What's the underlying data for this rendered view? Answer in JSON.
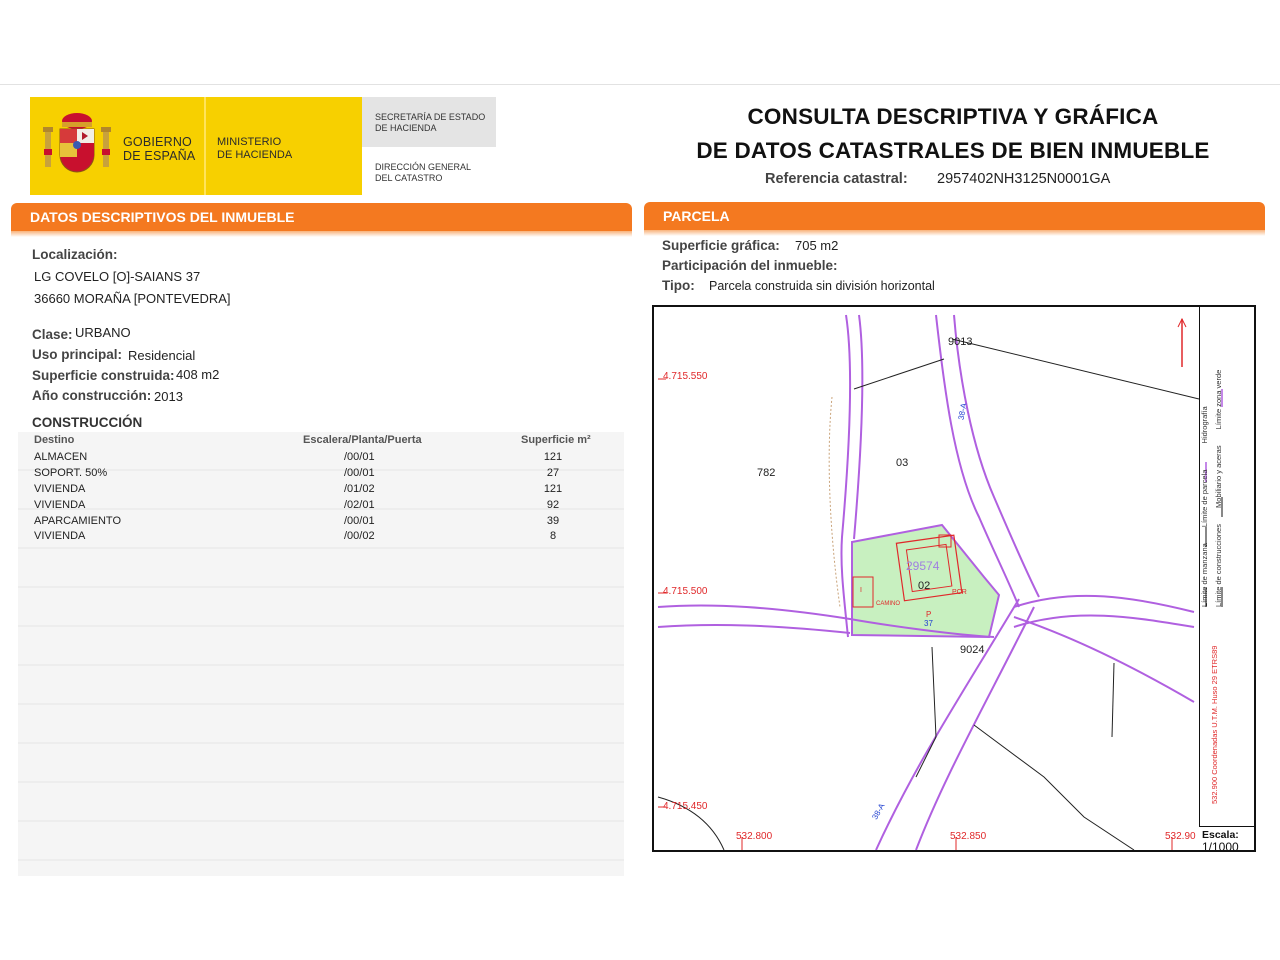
{
  "header": {
    "gobierno": [
      "GOBIERNO",
      "DE ESPAÑA"
    ],
    "ministerio": [
      "MINISTERIO",
      "DE HACIENDA"
    ],
    "secretaria": [
      "SECRETARÍA DE ESTADO",
      "DE HACIENDA"
    ],
    "direccion": [
      "DIRECCIÓN GENERAL",
      "DEL CATASTRO"
    ],
    "title_line1": "CONSULTA DESCRIPTIVA Y GRÁFICA",
    "title_line2": "DE DATOS CATASTRALES DE BIEN INMUEBLE",
    "ref_label": "Referencia catastral:",
    "ref_value": "2957402NH3125N0001GA"
  },
  "left": {
    "heading": "DATOS DESCRIPTIVOS DEL INMUEBLE",
    "localizacion_label": "Localización:",
    "address_line1": "LG COVELO [O]-SAIANS 37",
    "address_line2": "36660 MORAÑA [PONTEVEDRA]",
    "clase_label": "Clase:",
    "clase_value": "URBANO",
    "uso_label": "Uso principal:",
    "uso_value": "Residencial",
    "sup_label": "Superficie construida:",
    "sup_value": "408 m2",
    "anio_label": "Año construcción:",
    "anio_value": "2013",
    "construccion_title": "CONSTRUCCIÓN",
    "table": {
      "headers": [
        "Destino",
        "Escalera/Planta/Puerta",
        "Superficie m²"
      ],
      "rows": [
        [
          "ALMACEN",
          "/00/01",
          "121"
        ],
        [
          "SOPORT. 50%",
          "/00/01",
          "27"
        ],
        [
          "VIVIENDA",
          "/01/02",
          "121"
        ],
        [
          "VIVIENDA",
          "/02/01",
          "92"
        ],
        [
          "APARCAMIENTO",
          "/00/01",
          "39"
        ],
        [
          "VIVIENDA",
          "/00/02",
          "8"
        ]
      ]
    }
  },
  "right": {
    "heading": "PARCELA",
    "sup_grafica_label": "Superficie gráfica:",
    "sup_grafica_value": "705 m2",
    "participacion_label": "Participación del inmueble:",
    "tipo_label": "Tipo:",
    "tipo_value": "Parcela construida sin división horizontal"
  },
  "map": {
    "coord_y": [
      "4.715.550",
      "4.715.500",
      "4.715.450"
    ],
    "coord_x": [
      "532.800",
      "532.850",
      "532.90"
    ],
    "parcel_labels": [
      "9013",
      "782",
      "03",
      "29574",
      "02",
      "9024",
      "P",
      "37",
      "38-A",
      "38-A",
      "PCR",
      "CAMINO",
      "I"
    ],
    "legend": {
      "col1": [
        "Límite de manzana",
        "Límite de parcela",
        "Límite de construcciones",
        "Mobiliario y aceras",
        "Límite zona verde",
        "Hidrografía"
      ],
      "coords_text": "532.900 Coordenadas U.T.M. Huso 29 ETRS89"
    },
    "scale_label": "Escala:",
    "scale_value": "1/1000",
    "colors": {
      "boundary": "#b060e0",
      "green": "#c8f0c0",
      "red": "#e0282a",
      "block": "#222222"
    }
  }
}
